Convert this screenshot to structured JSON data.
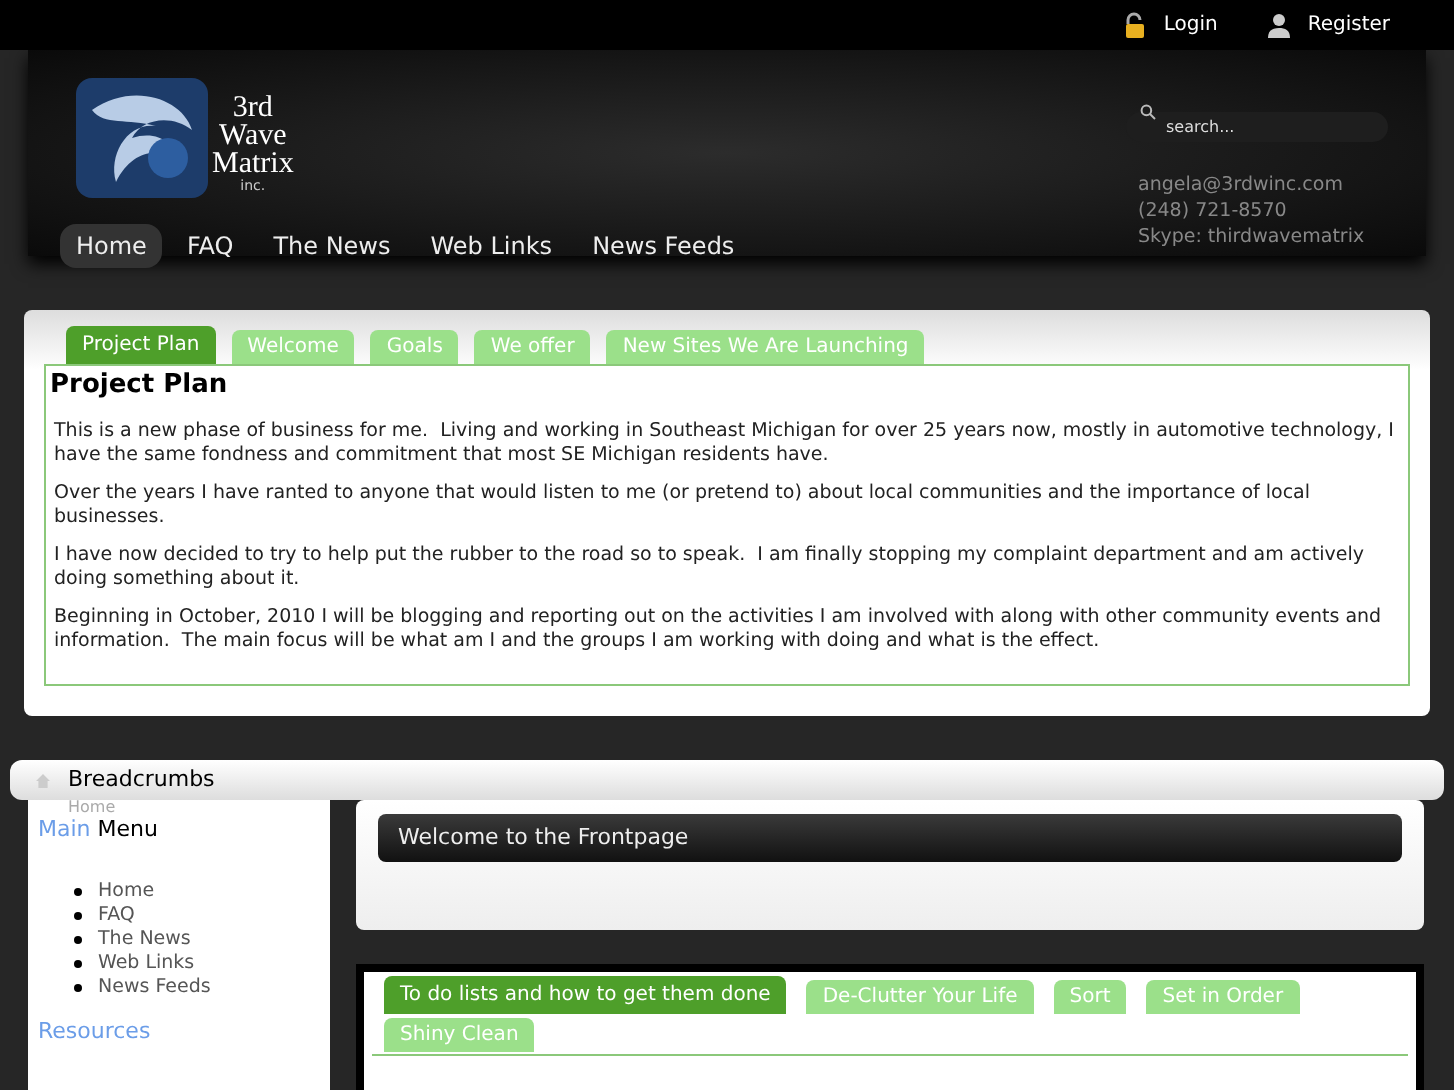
{
  "top_bar": {
    "links": [
      {
        "kind": "login",
        "label": "Login"
      },
      {
        "kind": "register",
        "label": "Register"
      }
    ]
  },
  "logo": {
    "lines": [
      "3rd",
      "Wave",
      "Matrix"
    ],
    "sub": "inc."
  },
  "search": {
    "placeholder": "search..."
  },
  "contact": [
    "angela@3rdwinc.com",
    "(248) 721-8570",
    "Skype: thirdwavematrix"
  ],
  "nav": [
    {
      "label": "Home",
      "selected": true
    },
    {
      "label": "FAQ",
      "selected": false
    },
    {
      "label": "The News",
      "selected": false
    },
    {
      "label": "Web Links",
      "selected": false
    },
    {
      "label": "News Feeds",
      "selected": false
    }
  ],
  "project_tabs": [
    {
      "label": "Project Plan",
      "selected": true
    },
    {
      "label": "Welcome",
      "selected": false
    },
    {
      "label": "Goals",
      "selected": false
    },
    {
      "label": "We offer",
      "selected": false
    },
    {
      "label": "New Sites We Are Launching",
      "selected": false
    }
  ],
  "project": {
    "heading": "Project Plan",
    "paragraphs": [
      "This is a new phase of business for me.  Living and working in Southeast Michigan for over 25 years now, mostly in automotive technology, I have the same fondness and commitment that most SE Michigan residents have.",
      "Over the years I have ranted to anyone that would listen to me (or pretend to) about local communities and the importance of local businesses.",
      "I have now decided to try to help put the rubber to the road so to speak.  I am finally stopping my complaint department and am actively doing something about it.",
      "Beginning in October, 2010 I will be blogging and reporting out on the activities I am involved with along with other community events and information.  The main focus will be what am I and the groups I am working with doing and what is the effect."
    ]
  },
  "breadcrumbs": {
    "title": "Breadcrumbs",
    "trail": "Home"
  },
  "sidebar": {
    "title_first": "Main",
    "title_rest": "Menu",
    "items": [
      "Home",
      "FAQ",
      "The News",
      "Web Links",
      "News Feeds"
    ],
    "resources": "Resources"
  },
  "frontpage": {
    "title": "Welcome to the Frontpage"
  },
  "todo_tabs": [
    {
      "label": "To do lists and how to get them done",
      "selected": true
    },
    {
      "label": "De-Clutter Your Life",
      "selected": false
    },
    {
      "label": "Sort",
      "selected": false
    },
    {
      "label": "Set in Order",
      "selected": false
    },
    {
      "label": "Shiny Clean",
      "selected": false
    }
  ]
}
